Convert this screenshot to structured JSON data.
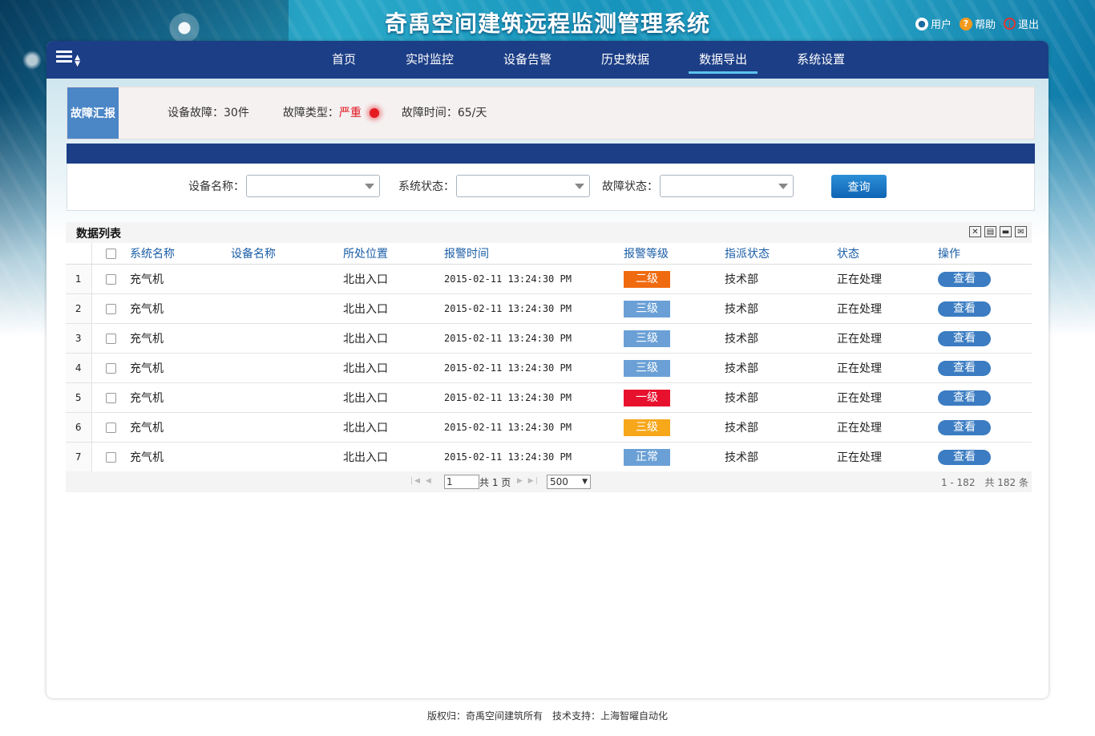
{
  "app": {
    "title": "奇禹空间建筑远程监测管理系统"
  },
  "top_links": {
    "user": "用户",
    "help": "帮助",
    "logout": "退出"
  },
  "nav": {
    "items": [
      "首页",
      "实时监控",
      "设备告警",
      "历史数据",
      "数据导出",
      "系统设置"
    ],
    "active": "数据导出"
  },
  "report": {
    "tag": "故障汇报",
    "device_fault": "设备故障：30件",
    "fault_type_label": "故障类型：",
    "fault_type_value": "严重",
    "fault_time": "故障时间：65/天",
    "severity_color": "#e0141e"
  },
  "filters": {
    "device_name_label": "设备名称：",
    "system_status_label": "系统状态：",
    "fault_status_label": "故障状态：",
    "device_name_value": "",
    "system_status_value": "",
    "fault_status_value": "",
    "query_button": "查询"
  },
  "list": {
    "title": "数据列表",
    "tools": [
      "close-icon",
      "export-icon",
      "print-icon",
      "mail-icon"
    ],
    "columns": [
      "系统名称",
      "设备名称",
      "所处位置",
      "报警时间",
      "报警等级",
      "指派状态",
      "状态",
      "操作"
    ],
    "rows": [
      {
        "num": "1",
        "system": "充气机",
        "device": "",
        "location": "北出入口",
        "time": "2015-02-11 13:24:30 PM",
        "level": "二级",
        "level_color": "#f06a10",
        "assign": "技术部",
        "status": "正在处理",
        "action": "查看"
      },
      {
        "num": "2",
        "system": "充气机",
        "device": "",
        "location": "北出入口",
        "time": "2015-02-11 13:24:30 PM",
        "level": "三级",
        "level_color": "#6aa0d6",
        "assign": "技术部",
        "status": "正在处理",
        "action": "查看"
      },
      {
        "num": "3",
        "system": "充气机",
        "device": "",
        "location": "北出入口",
        "time": "2015-02-11 13:24:30 PM",
        "level": "三级",
        "level_color": "#6aa0d6",
        "assign": "技术部",
        "status": "正在处理",
        "action": "查看"
      },
      {
        "num": "4",
        "system": "充气机",
        "device": "",
        "location": "北出入口",
        "time": "2015-02-11 13:24:30 PM",
        "level": "三级",
        "level_color": "#6aa0d6",
        "assign": "技术部",
        "status": "正在处理",
        "action": "查看"
      },
      {
        "num": "5",
        "system": "充气机",
        "device": "",
        "location": "北出入口",
        "time": "2015-02-11 13:24:30 PM",
        "level": "一级",
        "level_color": "#e8112d",
        "assign": "技术部",
        "status": "正在处理",
        "action": "查看"
      },
      {
        "num": "6",
        "system": "充气机",
        "device": "",
        "location": "北出入口",
        "time": "2015-02-11 13:24:30 PM",
        "level": "三级",
        "level_color": "#f7a71a",
        "assign": "技术部",
        "status": "正在处理",
        "action": "查看"
      },
      {
        "num": "7",
        "system": "充气机",
        "device": "",
        "location": "北出入口",
        "time": "2015-02-11 13:24:30 PM",
        "level": "正常",
        "level_color": "#6aa0d6",
        "assign": "技术部",
        "status": "正在处理",
        "action": "查看"
      }
    ]
  },
  "pager": {
    "page_input": "1",
    "total_pages": "共 1 页",
    "page_size": "500",
    "range": "1 - 182　共 182 条"
  },
  "footer": {
    "text": "版权归：奇禹空间建筑所有　技术支持：上海智曜自动化"
  }
}
